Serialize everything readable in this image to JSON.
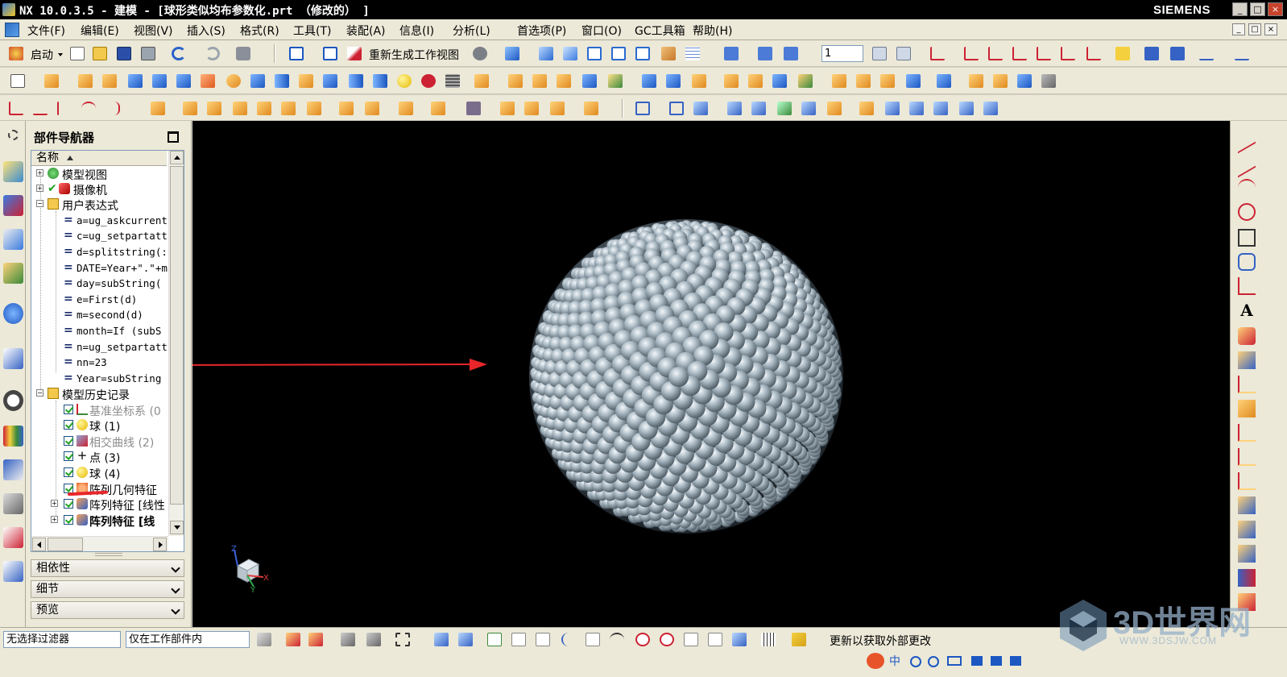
{
  "window": {
    "title": "NX 10.0.3.5 - 建模 - [球形类似均布参数化.prt （修改的） ]",
    "brand": "SIEMENS",
    "controls": [
      "_",
      "□",
      "×"
    ]
  },
  "menubar": {
    "items": [
      "文件(F)",
      "编辑(E)",
      "视图(V)",
      "插入(S)",
      "格式(R)",
      "工具(T)",
      "装配(A)",
      "信息(I)",
      "分析(L)",
      "首选项(P)",
      "窗口(O)",
      "GC工具箱",
      "帮助(H)"
    ]
  },
  "toolbar1": {
    "start_label": "启动",
    "regen_label": "重新生成工作视图",
    "layer_value": "1"
  },
  "part_navigator": {
    "title": "部件导航器",
    "column_header": "名称",
    "nodes": {
      "model_views": "模型视图",
      "cameras": "摄像机",
      "user_expressions": "用户表达式",
      "expressions": [
        "a=ug_askcurrent",
        "c=ug_setpartatt",
        "d=splitstring(:",
        "DATE=Year+\".\"+m",
        "day=subString(",
        "e=First(d)",
        "m=second(d)",
        "month=If (subS",
        "n=ug_setpartatt",
        "nn=23",
        "Year=subString"
      ],
      "model_history": "模型历史记录",
      "features": [
        {
          "label": "基准坐标系 (0",
          "style": "gray",
          "icon": "datum-csys-icon"
        },
        {
          "label": "球 (1)",
          "style": "normal",
          "icon": "sphere-icon"
        },
        {
          "label": "相交曲线 (2)",
          "style": "gray",
          "icon": "intersection-curve-icon"
        },
        {
          "label": "点 (3)",
          "style": "normal",
          "icon": "point-icon"
        },
        {
          "label": "球 (4)",
          "style": "normal",
          "icon": "sphere-icon"
        },
        {
          "label": "阵列几何特征",
          "style": "normal",
          "icon": "pattern-geometry-icon"
        },
        {
          "label": "阵列特征 [线性",
          "style": "normal",
          "icon": "pattern-feature-icon"
        },
        {
          "label": "阵列特征 [线",
          "style": "bold",
          "icon": "pattern-feature-icon"
        }
      ]
    },
    "sections": [
      "相依性",
      "细节",
      "预览"
    ]
  },
  "graphics": {
    "background": "#000000",
    "sphere_color": "#a9b8c2",
    "annotation_color": "#e8262a",
    "triad_labels": {
      "x": "X",
      "y": "Y",
      "z": "Z"
    }
  },
  "statusbar": {
    "filter_value": "无选择过滤器",
    "scope_value": "仅在工作部件内",
    "message": "更新以获取外部更改"
  },
  "watermark": {
    "text": "3D世界网",
    "url": "WWW.3DSJW.COM"
  }
}
